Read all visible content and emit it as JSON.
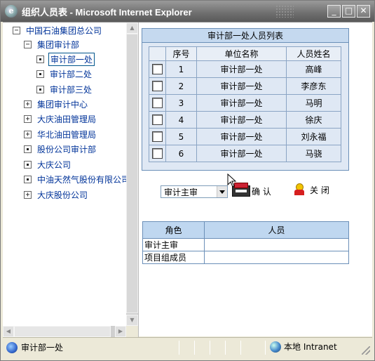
{
  "window": {
    "title": "组织人员表 - Microsoft Internet Explorer",
    "minimize": "_",
    "maximize": "□",
    "close": "✕"
  },
  "tree": {
    "items": [
      {
        "label": "中国石油集团总公司",
        "toggle": "−"
      },
      {
        "label": "集团审计部",
        "toggle": "−"
      },
      {
        "label": "审计部一处",
        "selected": true
      },
      {
        "label": "审计部二处"
      },
      {
        "label": "审计部三处"
      },
      {
        "label": "集团审计中心",
        "toggle": "+"
      },
      {
        "label": "大庆油田管理局",
        "toggle": "+"
      },
      {
        "label": "华北油田管理局",
        "toggle": "+"
      },
      {
        "label": "股份公司审计部"
      },
      {
        "label": "大庆公司"
      },
      {
        "label": "中油天然气股份有限公司"
      },
      {
        "label": "大庆股份公司",
        "toggle": "+"
      }
    ]
  },
  "staff_panel": {
    "title": "审计部一处人员列表",
    "columns": [
      "",
      "序号",
      "单位名称",
      "人员姓名"
    ],
    "rows": [
      {
        "no": "1",
        "unit": "审计部一处",
        "name": "高峰"
      },
      {
        "no": "2",
        "unit": "审计部一处",
        "name": "李彦东"
      },
      {
        "no": "3",
        "unit": "审计部一处",
        "name": "马明"
      },
      {
        "no": "4",
        "unit": "审计部一处",
        "name": "徐庆"
      },
      {
        "no": "5",
        "unit": "审计部一处",
        "name": "刘永福"
      },
      {
        "no": "6",
        "unit": "审计部一处",
        "name": "马骁"
      }
    ]
  },
  "controls": {
    "role_select": "审计主审",
    "confirm_label": "确 认",
    "close_label": "关 闭"
  },
  "role_table": {
    "columns": [
      "角色",
      "人员"
    ],
    "rows": [
      {
        "role": "审计主审",
        "person": ""
      },
      {
        "role": "项目组成员",
        "person": ""
      }
    ]
  },
  "statusbar": {
    "text": "审计部一处",
    "zone": "本地 Intranet"
  }
}
